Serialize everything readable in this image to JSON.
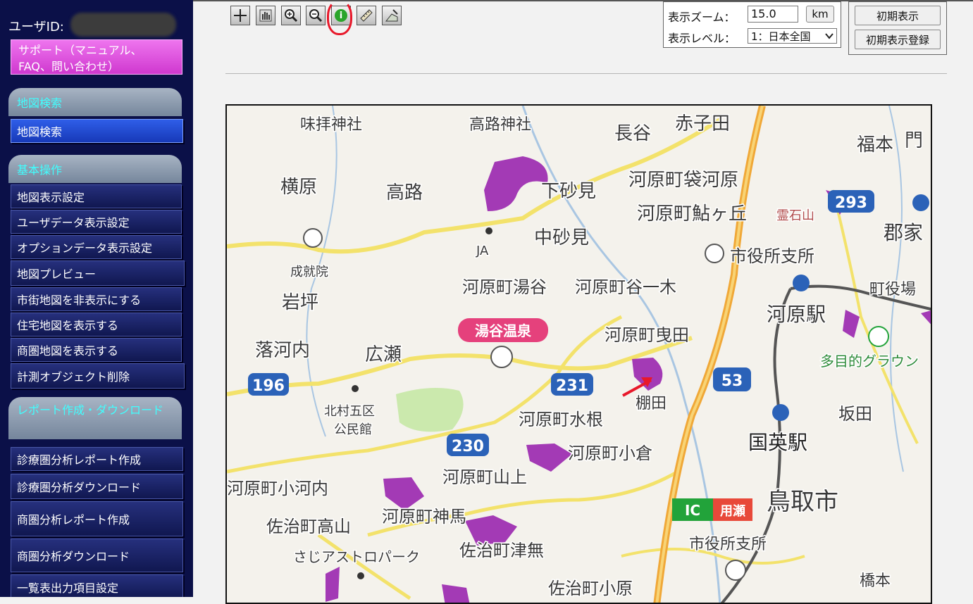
{
  "sidebar": {
    "user_label": "ユーザID:",
    "support_label": "サポート（マニュアル、FAQ、問い合わせ）",
    "sections": [
      {
        "title": "地図検索",
        "items": [
          "地図検索"
        ]
      },
      {
        "title": "基本操作",
        "items": [
          "地図表示設定",
          "ユーザデータ表示設定",
          "オプションデータ表示設定",
          "地図プレビュー",
          "市街地図を非表示にする",
          "住宅地図を表示する",
          "商圏地図を表示する",
          "計測オブジェクト削除"
        ]
      },
      {
        "title": "レポート作成・ダウンロード",
        "items": [
          "診療圏分析レポート作成",
          "診療圏分析ダウンロード",
          "商圏分析レポート作成",
          "商圏分析ダウンロード",
          "一覧表出力項目設定"
        ]
      }
    ]
  },
  "toolbar": {
    "tools": [
      {
        "name": "crosshair-tool-icon"
      },
      {
        "name": "pan-hand-tool-icon"
      },
      {
        "name": "zoom-in-tool-icon"
      },
      {
        "name": "zoom-out-tool-icon"
      },
      {
        "name": "info-tool-icon",
        "glyph": "i"
      },
      {
        "name": "ruler-measure-tool-icon"
      },
      {
        "name": "area-measure-tool-icon"
      }
    ],
    "zoom_label": "表示ズーム：",
    "zoom_value": "15.0",
    "zoom_unit": "km",
    "level_label": "表示レベル：",
    "level_value": "1：日本全国",
    "initial_display": "初期表示",
    "initial_display_register": "初期表示登録"
  },
  "map": {
    "labels": [
      "味拝神社",
      "高路神社",
      "長谷",
      "赤子田",
      "福本",
      "門",
      "横原",
      "高路",
      "下砂見",
      "河原町袋河原",
      "霊石山",
      "河原町鮎ヶ丘",
      "293",
      "郡家",
      "中砂見",
      "JA",
      "成就院",
      "市役所支所",
      "岩坪",
      "河原町湯谷",
      "河原町谷一木",
      "町役場",
      "河原駅",
      "湯谷温泉",
      "河原町曳田",
      "落河内",
      "広瀬",
      "多目的グラウン",
      "231",
      "53",
      "196",
      "北村五区",
      "公民館",
      "棚田",
      "坂田",
      "河原町水根",
      "国英駅",
      "230",
      "河原町小倉",
      "河原町小河内",
      "河原町山上",
      "鳥取市",
      "IC",
      "用瀬",
      "河原町神馬",
      "佐治町高山",
      "市役所支所",
      "さじアストロパーク",
      "佐治町津無",
      "佐治町小原",
      "橋本"
    ]
  },
  "colors": {
    "sidebar_bg": "#0b1048",
    "support_bg": "#e05ce0",
    "section_header_text": "#40ffff",
    "active_item": "#2446d0",
    "highlight_area": "#a33ab5",
    "road_yellow": "#f3e26b",
    "expressway_orange": "#f0a838",
    "annotation_red": "#e8182a"
  }
}
